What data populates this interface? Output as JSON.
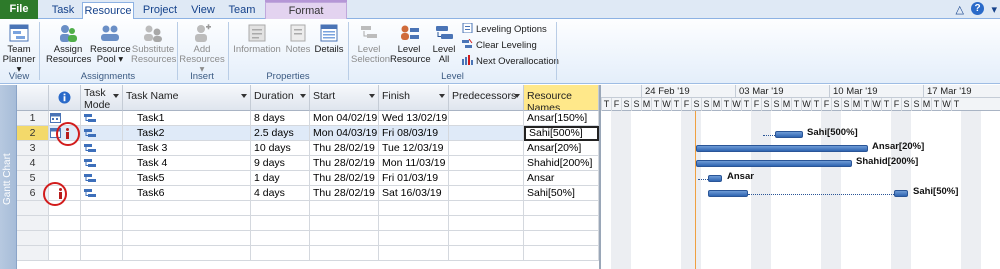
{
  "ribbon_tabs": [
    "File",
    "Task",
    "Resource",
    "Project",
    "View",
    "Team",
    "Format"
  ],
  "active_tab": "Resource",
  "ribbon": {
    "view_group": {
      "label": "View",
      "team_planner": "Team Planner ▾",
      "team_planner_line1": "Team",
      "team_planner_line2": "Planner ▾"
    },
    "assignments_group": {
      "label": "Assignments",
      "assign_line1": "Assign",
      "assign_line2": "Resources",
      "pool_line1": "Resource",
      "pool_line2": "Pool ▾",
      "sub_line1": "Substitute",
      "sub_line2": "Resources"
    },
    "insert_group": {
      "label": "Insert",
      "add_line1": "Add",
      "add_line2": "Resources ▾"
    },
    "properties_group": {
      "label": "Properties",
      "information": "Information",
      "notes": "Notes",
      "details": "Details"
    },
    "level_group": {
      "label": "Level",
      "sel_line1": "Level",
      "sel_line2": "Selection",
      "res_line1": "Level",
      "res_line2": "Resource",
      "all_line1": "Level",
      "all_line2": "All",
      "options": "Leveling Options",
      "clear": "Clear Leveling",
      "next": "Next Overallocation"
    }
  },
  "sidebar_label": "Gantt Chart",
  "columns": {
    "task_mode_line1": "Task",
    "task_mode_line2": "Mode",
    "task_name": "Task Name",
    "duration": "Duration",
    "start": "Start",
    "finish": "Finish",
    "predecessors": "Predecessors",
    "resource_names": "Resource Names"
  },
  "tasks": [
    {
      "id": "1",
      "name": "Task1",
      "duration": "8 days",
      "start": "Mon 04/02/19",
      "finish": "Wed 13/02/19",
      "predecessors": "",
      "resources": "Ansar[150%]"
    },
    {
      "id": "2",
      "name": "Task2",
      "duration": "2.5 days",
      "start": "Mon 04/03/19",
      "finish": "Fri 08/03/19",
      "predecessors": "",
      "resources": "Sahi[500%]"
    },
    {
      "id": "3",
      "name": "Task 3",
      "duration": "10 days",
      "start": "Thu 28/02/19",
      "finish": "Tue 12/03/19",
      "predecessors": "",
      "resources": "Ansar[20%]"
    },
    {
      "id": "4",
      "name": "Task 4",
      "duration": "9 days",
      "start": "Thu 28/02/19",
      "finish": "Mon 11/03/19",
      "predecessors": "",
      "resources": "Shahid[200%]"
    },
    {
      "id": "5",
      "name": "Task5",
      "duration": "1 day",
      "start": "Thu 28/02/19",
      "finish": "Fri 01/03/19",
      "predecessors": "",
      "resources": "Ansar"
    },
    {
      "id": "6",
      "name": "Task6",
      "duration": "4 days",
      "start": "Thu 28/02/19",
      "finish": "Sat 16/03/19",
      "predecessors": "",
      "resources": "Sahi[50%]"
    }
  ],
  "timeline": {
    "weeks": [
      "24 Feb '19",
      "03 Mar '19",
      "10 Mar '19",
      "17 Mar '19"
    ],
    "days": [
      "T",
      "F",
      "S",
      "S",
      "M",
      "T",
      "W",
      "T",
      "F",
      "S",
      "S",
      "M",
      "T",
      "W",
      "T",
      "F",
      "S",
      "S",
      "M",
      "T",
      "W",
      "T",
      "F",
      "S",
      "S",
      "M",
      "T",
      "W",
      "T",
      "F",
      "S",
      "S",
      "M",
      "T",
      "W",
      "T"
    ]
  },
  "gantt_labels": [
    "Sahi[500%]",
    "Ansar[20%]",
    "Shahid[200%]",
    "Ansar",
    "Sahi[50%]"
  ],
  "colors": {
    "bar": "#2f64b1",
    "overallocated_indicator": "#b71c1c",
    "annotation_circle": "#d21c1c",
    "resource_header": "#ffe88a",
    "file_tab": "#2d7a2a"
  }
}
